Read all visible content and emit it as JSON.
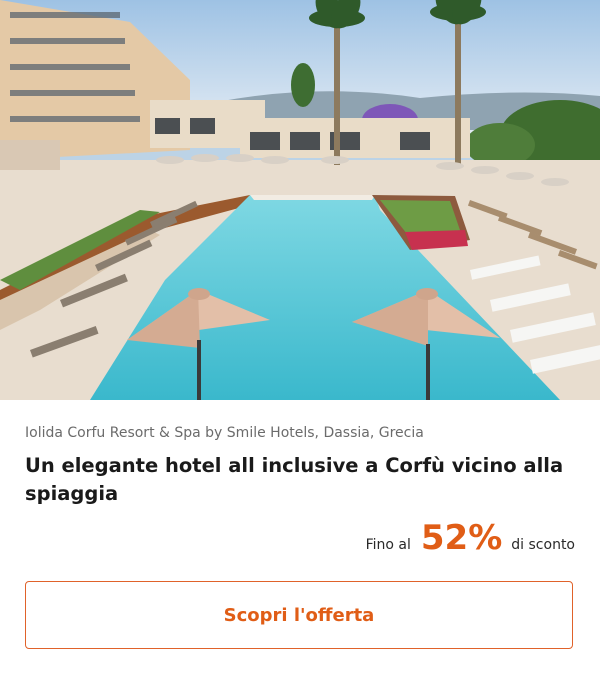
{
  "offer": {
    "location": "Iolida Corfu Resort & Spa by Smile Hotels, Dassia, Grecia",
    "title": "Un elegante hotel all inclusive a Corfù vicino alla spiaggia",
    "discount_prefix": "Fino al",
    "discount_value": "52%",
    "discount_suffix": "di sconto",
    "cta_label": "Scopri l'offerta"
  },
  "colors": {
    "accent": "#e05d16",
    "pool": "#4ec5d6",
    "umbrella": "#e3bfa8"
  }
}
